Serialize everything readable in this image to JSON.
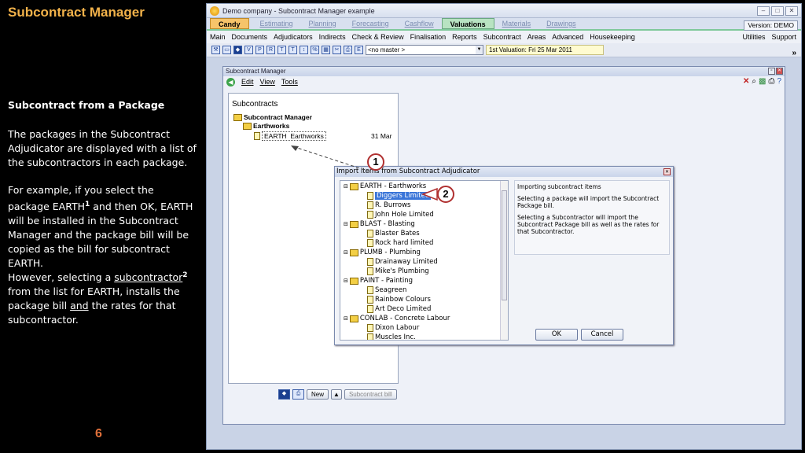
{
  "left": {
    "title": "Subcontract Manager",
    "heading": "Subcontract from a Package",
    "para1": "The packages in the Subcontract Adjudicator are displayed with a list of the subcontractors in each package.",
    "para2_a": "For example, if you select the package EARTH",
    "para2_sup": "1",
    "para2_b": " and then OK, EARTH will be installed in the Subcontract Manager and the package bill will be copied as the bill for subcontract EARTH.",
    "para3_a": "However, selecting a ",
    "para3_link": "subcontractor",
    "para3_sup": "2",
    "para3_b": " from the list for EARTH, installs the package bill ",
    "para3_and": "and",
    "para3_c": " the rates for that subcontractor.",
    "page_number": "6"
  },
  "app": {
    "window_title": "Demo company - Subcontract Manager example",
    "tabs": [
      "Candy",
      "Estimating",
      "Planning",
      "Forecasting",
      "Cashflow",
      "Valuations",
      "Materials",
      "Drawings"
    ],
    "active_tab": "Valuations",
    "version": "Version: DEMO",
    "menu": [
      "Main",
      "Documents",
      "Adjudicators",
      "Indirects",
      "Check & Review",
      "Finalisation",
      "Reports",
      "Subcontract",
      "Areas",
      "Advanced",
      "Housekeeping"
    ],
    "menu_right": [
      "Utilities",
      "Support"
    ],
    "master_combo": "<no master >",
    "valuation": "1st Valuation: Fri 25 Mar 2011"
  },
  "inner": {
    "title": "Subcontract Manager",
    "menu": [
      "Edit",
      "View",
      "Tools"
    ],
    "tree_header": "Subcontracts",
    "root": "Subcontract Manager",
    "group": "Earthworks",
    "item_code": "EARTH",
    "item_name": "Earthworks",
    "item_date": "31 Mar",
    "new_button": "New",
    "subcontract_bill_button": "Subcontract bill"
  },
  "dialog": {
    "title": "Import items from Subcontract Adjudicator",
    "packages": [
      {
        "name": "EARTH - Earthworks",
        "subs": [
          "Diggers Limited",
          "R. Burrows",
          "John Hole Limited"
        ]
      },
      {
        "name": "BLAST - Blasting",
        "subs": [
          "Blaster Bates",
          "Rock hard limited"
        ]
      },
      {
        "name": "PLUMB - Plumbing",
        "subs": [
          "Drainaway Limited",
          "Mike's Plumbing"
        ]
      },
      {
        "name": "PAINT - Painting",
        "subs": [
          "Seagreen",
          "Rainbow Colours",
          "Art Deco Limited"
        ]
      },
      {
        "name": "CONLAB - Concrete Labour",
        "subs": [
          "Dixon Labour",
          "Muscles Inc."
        ]
      }
    ],
    "selected": "Diggers Limited",
    "info_title": "Importing subcontract items",
    "info_1": "Selecting a package will import the Subcontract Package bill.",
    "info_2": "Selecting a Subcontractor will import the Subcontract Package bill as well as the rates for that Subcontractor.",
    "ok": "OK",
    "cancel": "Cancel"
  },
  "callouts": [
    "1",
    "2"
  ],
  "colors": {
    "title": "#f2b24a",
    "page_number": "#e0703a",
    "callout_border": "#b03030",
    "active_tab": "#b8e3c2"
  }
}
